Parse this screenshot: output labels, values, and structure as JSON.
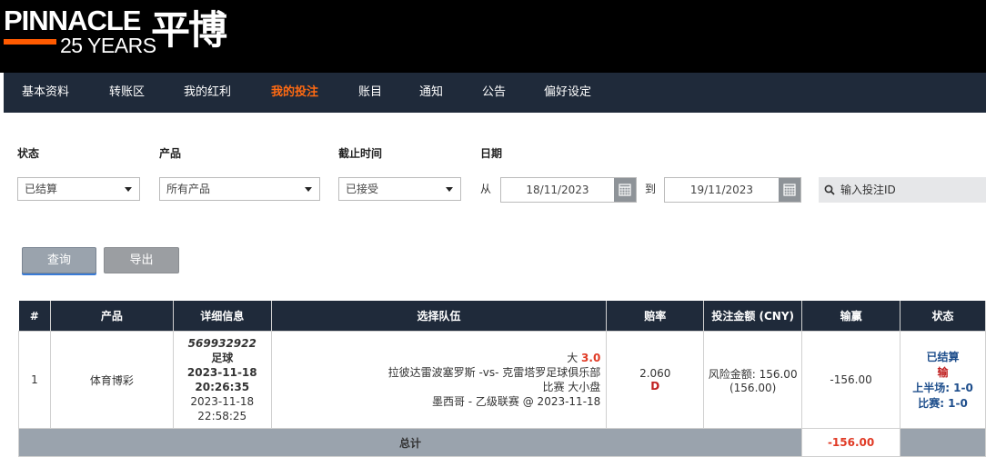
{
  "brand": {
    "name": "PINNACLE",
    "tagline": "25 YEARS",
    "chinese": "平博"
  },
  "nav": {
    "items": [
      {
        "label": "基本资料",
        "active": false
      },
      {
        "label": "转账区",
        "active": false
      },
      {
        "label": "我的红利",
        "active": false
      },
      {
        "label": "我的投注",
        "active": true
      },
      {
        "label": "账目",
        "active": false
      },
      {
        "label": "通知",
        "active": false
      },
      {
        "label": "公告",
        "active": false
      },
      {
        "label": "偏好设定",
        "active": false
      }
    ],
    "active_color": "#ff6a12"
  },
  "filters": {
    "status_label": "状态",
    "status_value": "已结算",
    "product_label": "产品",
    "product_value": "所有产品",
    "deadline_label": "截止时间",
    "deadline_value": "已接受",
    "date_label": "日期",
    "from_label": "从",
    "from_date": "18/11/2023",
    "to_label": "到",
    "to_date": "19/11/2023",
    "search_placeholder": "输入投注ID"
  },
  "actions": {
    "query_label": "查询",
    "export_label": "导出"
  },
  "table": {
    "headers": [
      "#",
      "产品",
      "详细信息",
      "选择队伍",
      "赔率",
      "投注金额 (CNY)",
      "输赢",
      "状态"
    ],
    "rows": [
      {
        "num": "1",
        "product": "体育博彩",
        "bet_id": "569932922",
        "sport": "足球",
        "placed_date": "2023-11-18",
        "placed_time": "20:26:35",
        "settled_date": "2023-11-18",
        "settled_time": "22:58:25",
        "selection_side": "大",
        "selection_line": "3.0",
        "match": "拉彼达雷波塞罗斯 -vs- 克雷塔罗足球俱乐部",
        "market": "比赛 大小盘",
        "league_date": "墨西哥 - 乙级联赛 @ 2023-11-18",
        "odds": "2.060",
        "odds_format": "D",
        "stake": "风险金额: 156.00",
        "stake_paren": "(156.00)",
        "win_loss": "-156.00",
        "status": "已结算",
        "result": "输",
        "first_half": "上半场: 1-0",
        "full_time": "比赛: 1-0"
      }
    ],
    "total_label": "总计",
    "total_win_loss": "-156.00"
  }
}
